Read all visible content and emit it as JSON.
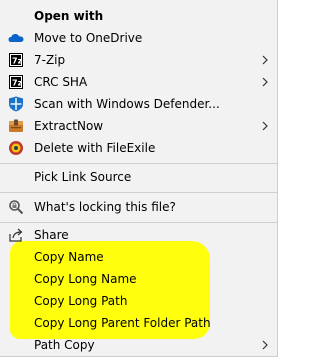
{
  "menu": {
    "items": [
      {
        "label": "Open with",
        "icon": "none",
        "submenu": false,
        "bold": true
      },
      {
        "label": "Move to OneDrive",
        "icon": "onedrive-cloud-icon",
        "submenu": false
      },
      {
        "label": "7-Zip",
        "icon": "7zip-icon",
        "submenu": true
      },
      {
        "label": "CRC SHA",
        "icon": "7zip-icon",
        "submenu": true
      },
      {
        "label": "Scan with Windows Defender...",
        "icon": "windows-defender-icon",
        "submenu": false
      },
      {
        "label": "ExtractNow",
        "icon": "extractnow-icon",
        "submenu": true
      },
      {
        "label": "Delete with FileExile",
        "icon": "fileexile-icon",
        "submenu": false
      },
      {
        "label": "Pick Link Source",
        "icon": "none",
        "submenu": false
      },
      {
        "label": "What's locking this file?",
        "icon": "lock-search-icon",
        "submenu": false
      },
      {
        "label": "Share",
        "icon": "share-icon",
        "submenu": false
      },
      {
        "label": "Copy Name",
        "icon": "none",
        "submenu": false
      },
      {
        "label": "Copy Long Name",
        "icon": "none",
        "submenu": false
      },
      {
        "label": "Copy Long Path",
        "icon": "none",
        "submenu": false
      },
      {
        "label": "Copy Long Parent Folder Path",
        "icon": "none",
        "submenu": false
      },
      {
        "label": "Path Copy",
        "icon": "none",
        "submenu": true
      }
    ]
  },
  "colors": {
    "menu_background": "#f2f2f2",
    "highlight": "#ffff00",
    "separator": "#cfcfcf"
  }
}
